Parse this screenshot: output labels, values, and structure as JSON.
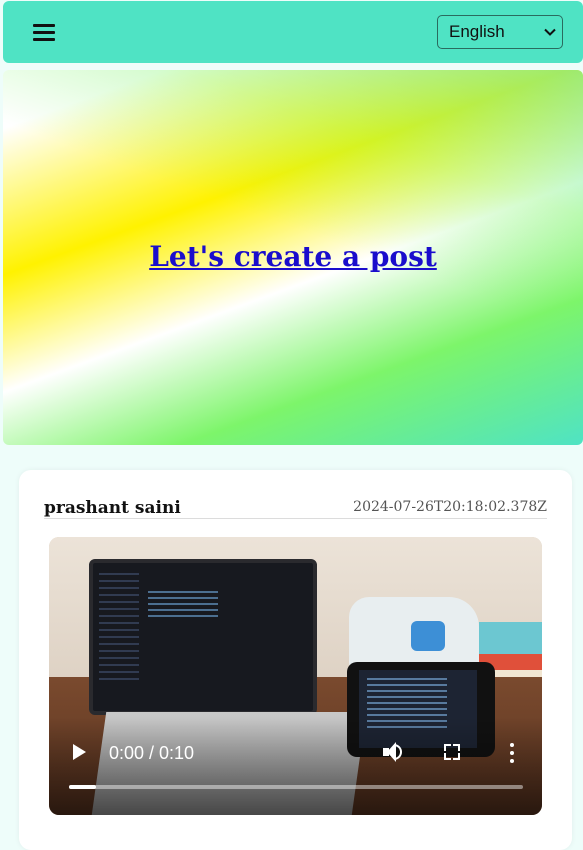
{
  "header": {
    "menu_icon": "hamburger-menu-icon",
    "language": {
      "selected": "English",
      "icon": "chevron-down-icon"
    }
  },
  "hero": {
    "link_text": "Let's create a post",
    "colors": {
      "link": "#1a0dcc",
      "topbar": "#4fe3c4"
    }
  },
  "post": {
    "author": "prashant saini",
    "timestamp": "2024-07-26T20:18:02.378Z",
    "video": {
      "time_display": "0:00 / 0:10",
      "progress": 0.06,
      "controls": [
        "play-icon",
        "volume-icon",
        "fullscreen-icon",
        "more-options-icon"
      ]
    }
  }
}
